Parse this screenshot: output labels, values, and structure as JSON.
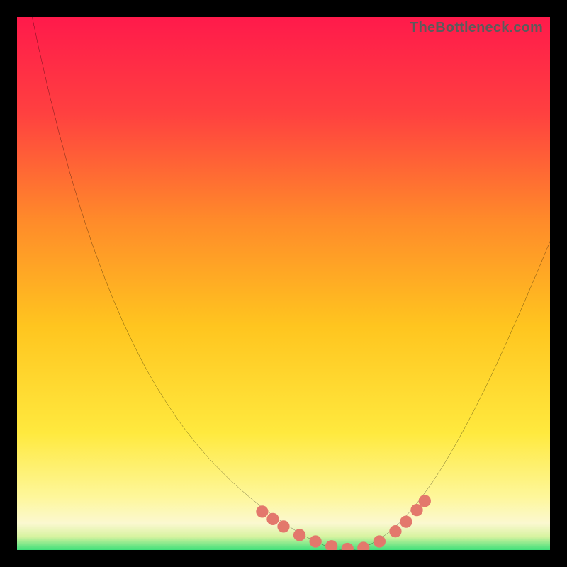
{
  "watermark": "TheBottleneck.com",
  "colors": {
    "frame": "#000000",
    "curve_stroke": "#000000",
    "marker_fill": "#e3786c",
    "bottom_band": "#3fe07a",
    "gradient_top": "#ff1a4b",
    "gradient_mid1": "#ff7a2a",
    "gradient_mid2": "#ffe03a",
    "gradient_light": "#fdf7a8"
  },
  "chart_data": {
    "type": "line",
    "title": "",
    "xlabel": "",
    "ylabel": "",
    "xlim": [
      0,
      100
    ],
    "ylim": [
      0,
      100
    ],
    "x": [
      0,
      2,
      4,
      6,
      8,
      10,
      12,
      14,
      16,
      18,
      20,
      22,
      24,
      26,
      28,
      30,
      32,
      34,
      36,
      38,
      40,
      42,
      44,
      46,
      48,
      50,
      52,
      54,
      56,
      58,
      60,
      62,
      64,
      66,
      68,
      70,
      72,
      74,
      76,
      78,
      80,
      82,
      84,
      86,
      88,
      90,
      92,
      94,
      96,
      98,
      100
    ],
    "series": [
      {
        "name": "bottleneck_curve",
        "values": [
          115,
          104,
          94.5,
          85.8,
          77.8,
          70.5,
          63.8,
          57.7,
          52.2,
          47.1,
          42.5,
          38.3,
          34.4,
          30.9,
          27.7,
          24.7,
          22,
          19.5,
          17.2,
          15.1,
          13.1,
          11.3,
          9.6,
          8,
          6.5,
          5.1,
          3.8,
          2.6,
          1.6,
          0.7,
          0.2,
          0,
          0.2,
          0.9,
          2,
          3.5,
          5.3,
          7.5,
          10,
          12.8,
          15.9,
          19.3,
          22.9,
          26.7,
          30.7,
          34.9,
          39.3,
          43.8,
          48.4,
          53.1,
          57.9
        ]
      }
    ],
    "markers": {
      "x": [
        46,
        48,
        50,
        53,
        56,
        59,
        62,
        65,
        68,
        71,
        73,
        75,
        76.5
      ],
      "y": [
        7.2,
        5.8,
        4.4,
        2.8,
        1.6,
        0.7,
        0.2,
        0.4,
        1.6,
        3.5,
        5.3,
        7.5,
        9.2
      ]
    },
    "green_band_y": 2.5
  }
}
